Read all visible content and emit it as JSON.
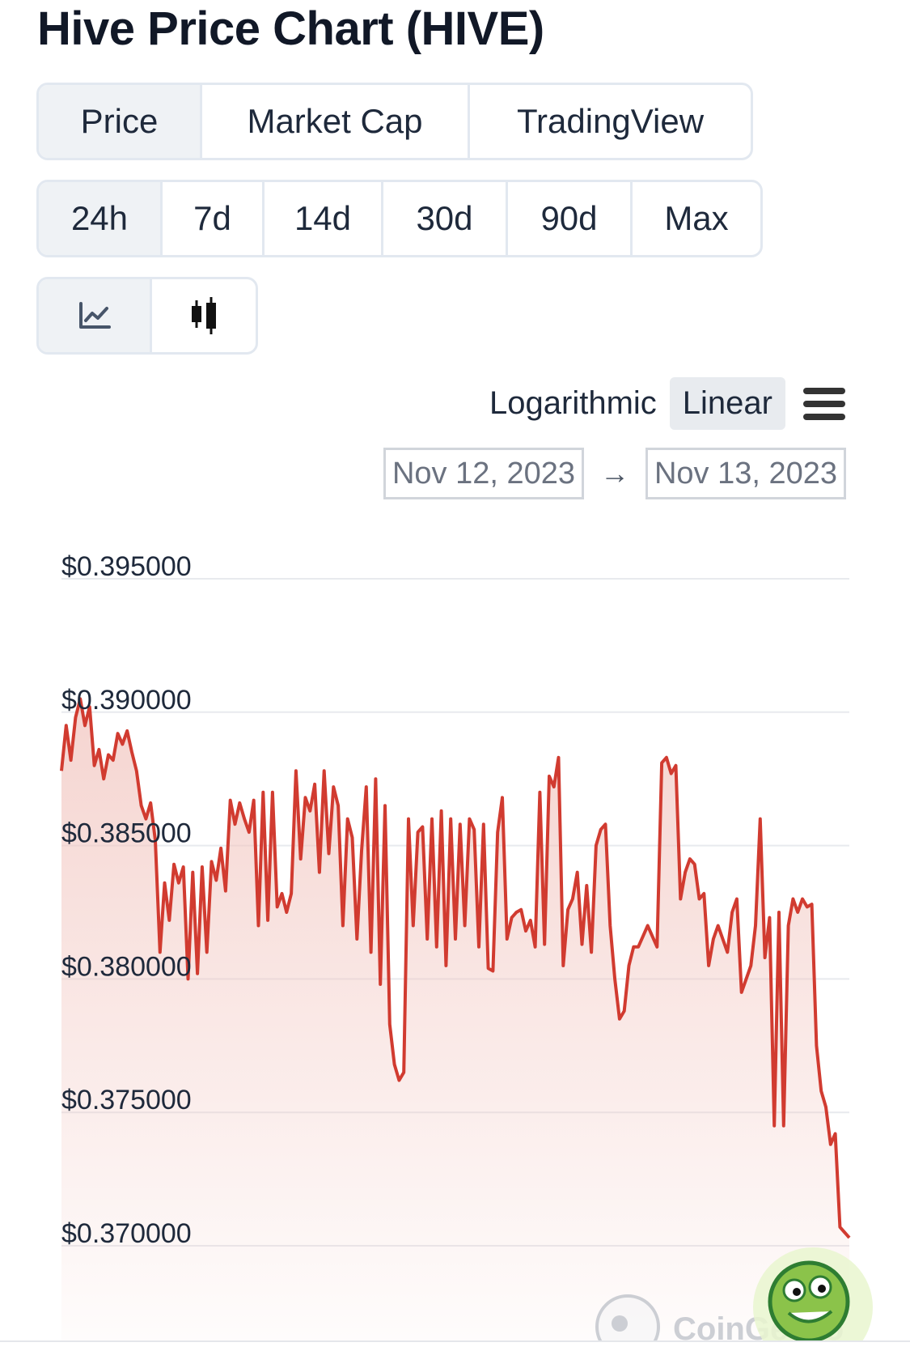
{
  "header": {
    "title": "Hive Price Chart (HIVE)"
  },
  "type_tabs": [
    {
      "label": "Price",
      "active": true
    },
    {
      "label": "Market Cap",
      "active": false
    },
    {
      "label": "TradingView",
      "active": false
    }
  ],
  "range_tabs": [
    {
      "label": "24h",
      "active": true
    },
    {
      "label": "7d",
      "active": false
    },
    {
      "label": "14d",
      "active": false
    },
    {
      "label": "30d",
      "active": false
    },
    {
      "label": "90d",
      "active": false
    },
    {
      "label": "Max",
      "active": false
    }
  ],
  "style_tabs": [
    {
      "icon": "line-chart-icon",
      "active": true
    },
    {
      "icon": "candlestick-icon",
      "active": false
    }
  ],
  "scale": {
    "log_label": "Logarithmic",
    "linear_label": "Linear",
    "active": "linear"
  },
  "date_range": {
    "from": "Nov 12, 2023",
    "arrow": "→",
    "to": "Nov 13, 2023"
  },
  "watermark": {
    "text": "CoinGecko"
  },
  "colors": {
    "line": "#d13b30",
    "grid": "#e8eaee",
    "active_tab": "#eff2f5",
    "fill": "#f2c6c0"
  },
  "chart_data": {
    "type": "line",
    "ylim": [
      0.3665,
      0.3965
    ],
    "y_ticks": [
      "$0.395000",
      "$0.390000",
      "$0.385000",
      "$0.380000",
      "$0.375000",
      "$0.370000"
    ],
    "y_tick_values": [
      0.395,
      0.39,
      0.385,
      0.38,
      0.375,
      0.37
    ],
    "series": [
      {
        "values": [
          0.3878,
          0.3895,
          0.3882,
          0.3898,
          0.3905,
          0.3895,
          0.3902,
          0.388,
          0.3886,
          0.3875,
          0.3884,
          0.3882,
          0.3892,
          0.3888,
          0.3893,
          0.3885,
          0.3878,
          0.3865,
          0.386,
          0.3866,
          0.3852,
          0.381,
          0.3836,
          0.3822,
          0.3843,
          0.3836,
          0.3842,
          0.38,
          0.384,
          0.3802,
          0.3842,
          0.381,
          0.3844,
          0.3837,
          0.3849,
          0.3833,
          0.3867,
          0.3858,
          0.3866,
          0.386,
          0.3855,
          0.3867,
          0.382,
          0.387,
          0.3822,
          0.387,
          0.3827,
          0.3832,
          0.3825,
          0.3832,
          0.3878,
          0.3845,
          0.3868,
          0.3863,
          0.3873,
          0.384,
          0.3878,
          0.3847,
          0.3872,
          0.3865,
          0.382,
          0.386,
          0.3853,
          0.3815,
          0.3848,
          0.3872,
          0.381,
          0.3875,
          0.3798,
          0.3865,
          0.3783,
          0.3768,
          0.3762,
          0.3765,
          0.386,
          0.382,
          0.3855,
          0.3857,
          0.3815,
          0.386,
          0.3812,
          0.3863,
          0.3805,
          0.386,
          0.3815,
          0.3858,
          0.382,
          0.386,
          0.3856,
          0.3812,
          0.3858,
          0.3804,
          0.3803,
          0.3855,
          0.3868,
          0.3815,
          0.3823,
          0.3825,
          0.3826,
          0.3818,
          0.3822,
          0.3812,
          0.387,
          0.3813,
          0.3876,
          0.3872,
          0.3883,
          0.3805,
          0.3826,
          0.383,
          0.384,
          0.3813,
          0.3835,
          0.381,
          0.385,
          0.3856,
          0.3858,
          0.382,
          0.38,
          0.3785,
          0.3788,
          0.3805,
          0.3812,
          0.3812,
          0.3816,
          0.382,
          0.3816,
          0.3812,
          0.3881,
          0.3883,
          0.3877,
          0.388,
          0.383,
          0.384,
          0.3845,
          0.3843,
          0.383,
          0.3832,
          0.3805,
          0.3815,
          0.382,
          0.3815,
          0.381,
          0.3825,
          0.383,
          0.3795,
          0.38,
          0.3805,
          0.382,
          0.386,
          0.3808,
          0.3823,
          0.3745,
          0.3825,
          0.3745,
          0.382,
          0.383,
          0.3825,
          0.383,
          0.3827,
          0.3828,
          0.3775,
          0.3758,
          0.3752,
          0.3738,
          0.3742,
          0.3707,
          0.3705,
          0.3703
        ]
      }
    ]
  }
}
